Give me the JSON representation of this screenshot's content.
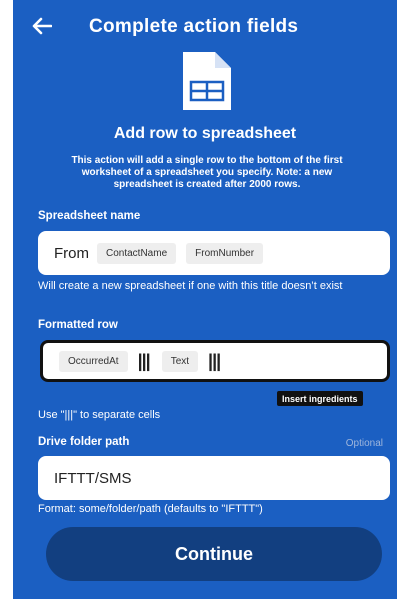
{
  "header": {
    "title": "Complete action fields"
  },
  "action": {
    "title": "Add row to spreadsheet",
    "description": "This action will add a single row to the bottom of the first worksheet of a spreadsheet you specify. Note: a new spreadsheet is created after 2000 rows."
  },
  "spreadsheet_name": {
    "label": "Spreadsheet name",
    "text": "From",
    "ingredients": [
      "ContactName",
      "FromNumber"
    ],
    "helper": "Will create a new spreadsheet if one with this title doesn’t exist"
  },
  "formatted_row": {
    "label": "Formatted row",
    "ingredients": [
      "OccurredAt",
      "Text"
    ],
    "separator": "|||",
    "insert_label": "Insert ingredients",
    "helper": "Use \"|||\" to separate cells"
  },
  "drive_folder": {
    "label": "Drive folder path",
    "optional": "Optional",
    "value": "IFTTT/SMS",
    "helper": "Format: some/folder/path (defaults to \"IFTTT\")"
  },
  "continue_label": "Continue",
  "colors": {
    "background": "#1b5fc2",
    "button": "#123f80",
    "field": "#ffffff"
  },
  "icons": {
    "back": "arrow-left",
    "spreadsheet": "spreadsheet-document"
  }
}
